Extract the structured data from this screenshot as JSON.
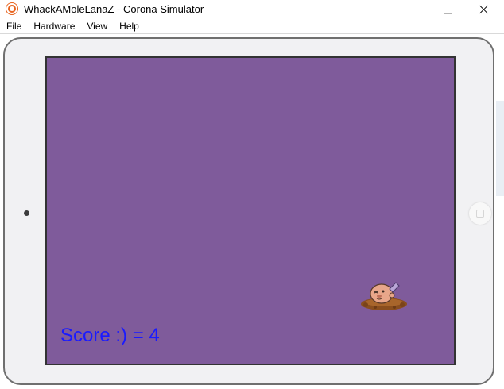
{
  "window": {
    "title": "WhackAMoleLanaZ - Corona Simulator",
    "controls": {
      "minimize": "minimize-icon",
      "maximize": "maximize-icon",
      "close": "close-icon"
    }
  },
  "menu": {
    "items": [
      "File",
      "Hardware",
      "View",
      "Help"
    ]
  },
  "game": {
    "background_color": "#7f5b9b",
    "score_text": "Score :) = 4",
    "score_color": "#1a1aff",
    "mole_icon": "mole-sprite"
  }
}
